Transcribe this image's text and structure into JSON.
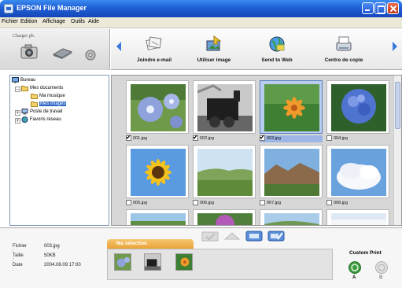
{
  "window": {
    "title": "EPSON File Manager"
  },
  "menu": [
    "Fichier",
    "Edition",
    "Affichage",
    "Outils",
    "Aide"
  ],
  "charger": {
    "label": "Charger ph."
  },
  "actions": [
    {
      "label": "Joindre e-mail",
      "icon": "email-attach-icon"
    },
    {
      "label": "Utiliser image",
      "icon": "use-image-icon"
    },
    {
      "label": "Send to Web",
      "icon": "send-web-icon"
    },
    {
      "label": "Centre de copie",
      "icon": "copy-center-icon"
    }
  ],
  "tree": [
    {
      "label": "Bureau",
      "icon": "desktop-icon",
      "selected": false
    },
    {
      "label": "Mes documents",
      "icon": "folder-open-icon",
      "selected": false
    },
    {
      "label": "Ma musique",
      "icon": "folder-icon",
      "selected": false
    },
    {
      "label": "Mes images",
      "icon": "folder-icon",
      "selected": true
    },
    {
      "label": "Poste de travail",
      "icon": "computer-icon",
      "selected": false
    },
    {
      "label": "Favoris réseau",
      "icon": "network-icon",
      "selected": false
    }
  ],
  "thumbnails": [
    {
      "filename": "001.jpg",
      "checked": true,
      "selected": false,
      "subject": "blue-flowers"
    },
    {
      "filename": "002.jpg",
      "checked": true,
      "selected": false,
      "subject": "locomotive"
    },
    {
      "filename": "003.jpg",
      "checked": true,
      "selected": true,
      "subject": "orange-flower"
    },
    {
      "filename": "004.jpg",
      "checked": false,
      "selected": false,
      "subject": "hydrangea"
    },
    {
      "filename": "005.jpg",
      "checked": false,
      "selected": false,
      "subject": "sunflower"
    },
    {
      "filename": "006.jpg",
      "checked": false,
      "selected": false,
      "subject": "field"
    },
    {
      "filename": "007.jpg",
      "checked": false,
      "selected": false,
      "subject": "rocks"
    },
    {
      "filename": "008.jpg",
      "checked": false,
      "selected": false,
      "subject": "clouds"
    },
    {
      "filename": "",
      "checked": false,
      "selected": false,
      "subject": "landscape"
    },
    {
      "filename": "",
      "checked": false,
      "selected": false,
      "subject": "purple-flower"
    },
    {
      "filename": "",
      "checked": false,
      "selected": false,
      "subject": "hills"
    },
    {
      "filename": "",
      "checked": false,
      "selected": false,
      "subject": "snow"
    }
  ],
  "info": {
    "fichier_label": "Fichier :",
    "fichier_value": "003.jpg",
    "taille_label": "Taille :",
    "taille_value": "50KB",
    "date_label": "Date :",
    "date_value": "2004.08.09 17:00"
  },
  "selection": {
    "tab_label": "Ma sélection",
    "items": [
      "001.jpg",
      "002.jpg",
      "003.jpg"
    ]
  },
  "custom_print": {
    "label": "Custom Print",
    "button_a": "A",
    "button_b": "B"
  },
  "colors": {
    "title_bar": "#1f5fd6",
    "selection_tab": "#e9a33a",
    "selected_thumb": "#b9cdee",
    "tree_selection": "#316ac5",
    "custom_print_green": "#3f9a3f"
  }
}
